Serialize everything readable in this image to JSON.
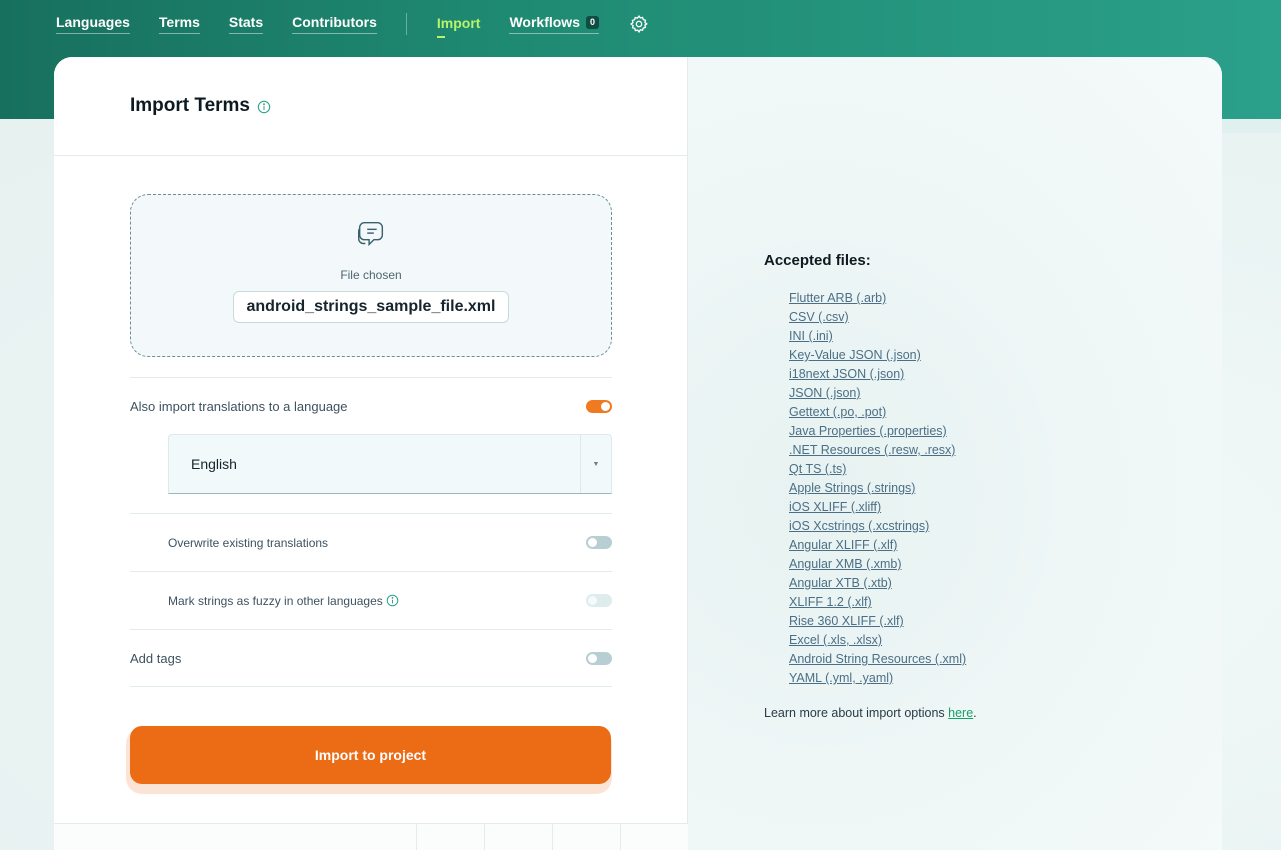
{
  "nav": {
    "items": [
      {
        "label": "Languages"
      },
      {
        "label": "Terms"
      },
      {
        "label": "Stats"
      },
      {
        "label": "Contributors"
      }
    ],
    "import_label": "Import",
    "workflows_label": "Workflows",
    "workflows_count": "0"
  },
  "panel": {
    "title": "Import Terms"
  },
  "dropzone": {
    "status_label": "File chosen",
    "file_name": "android_strings_sample_file.xml"
  },
  "options": {
    "also_import_label": "Also import translations to a language",
    "also_import_on": true,
    "language_selected": "English",
    "overwrite_label": "Overwrite existing translations",
    "overwrite_on": false,
    "fuzzy_label": "Mark strings as fuzzy in other languages",
    "fuzzy_on": false,
    "tags_label": "Add tags",
    "tags_on": false
  },
  "import_button_label": "Import to project",
  "accepted": {
    "title": "Accepted files:",
    "files": [
      "Flutter ARB (.arb)",
      "CSV (.csv)",
      "INI (.ini)",
      "Key-Value JSON (.json)",
      "i18next JSON (.json)",
      "JSON (.json)",
      "Gettext (.po, .pot)",
      "Java Properties (.properties)",
      ".NET Resources (.resw, .resx)",
      "Qt TS (.ts)",
      "Apple Strings (.strings)",
      "iOS XLIFF (.xliff)",
      "iOS Xcstrings (.xcstrings)",
      "Angular XLIFF (.xlf)",
      "Angular XMB (.xmb)",
      "Angular XTB (.xtb)",
      "XLIFF 1.2 (.xlf)",
      "Rise 360 XLIFF (.xlf)",
      "Excel (.xls, .xlsx)",
      "Android String Resources (.xml)",
      "YAML (.yml, .yaml)"
    ],
    "learn_more_prefix": "Learn more about import options ",
    "learn_more_link": "here",
    "learn_more_suffix": "."
  },
  "colors": {
    "header_green": "#17705e",
    "accent_orange": "#ec6b15",
    "active_nav": "#b7f36a",
    "link_blue": "#4b6f86",
    "link_green": "#17a06b"
  }
}
